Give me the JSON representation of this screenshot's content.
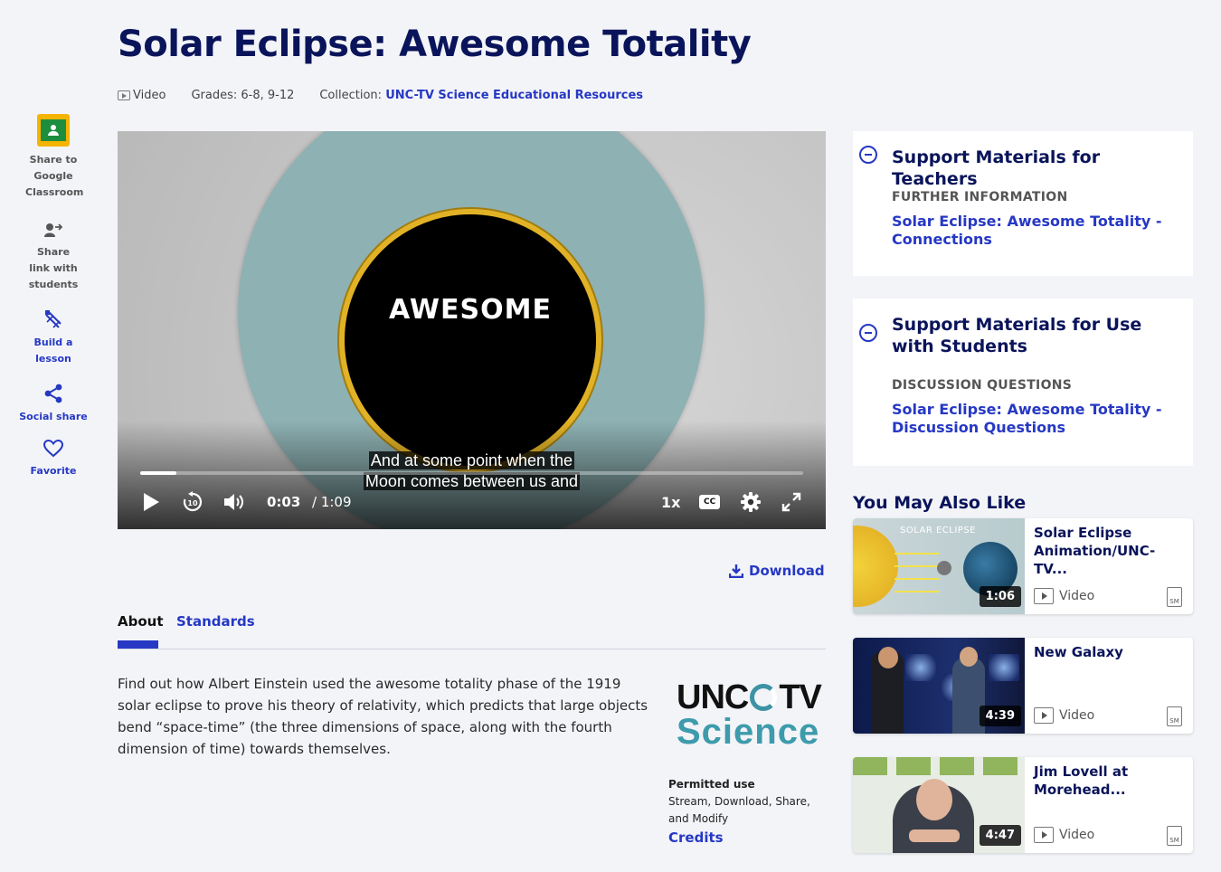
{
  "page": {
    "title": "Solar Eclipse: Awesome Totality",
    "media_type": "Video",
    "grades": "Grades: 6-8, 9-12",
    "collection_label": "Collection:",
    "collection_name": "UNC-TV Science Educational Resources"
  },
  "rail": {
    "google_classroom": "Share to Google Classroom",
    "share_link": "Share link with students",
    "build_lesson": "Build a lesson",
    "social_share": "Social share",
    "favorite": "Favorite"
  },
  "player": {
    "slide_word": "AWESOME",
    "caption_line1": "And at some point when the",
    "caption_line2": "Moon comes between us and",
    "current_time": "0:03",
    "duration": "/ 1:09",
    "progress_fraction": 0.055,
    "speed": "1x",
    "cc_label": "CC"
  },
  "download_label": "Download",
  "tabs": {
    "about": "About",
    "standards": "Standards"
  },
  "about_text": "Find out how Albert Einstein used the awesome totality phase of the 1919 solar eclipse to prove his theory of relativity, which predicts that large objects bend “space-time” (the three dimensions of space, along with the fourth dimension of time) towards themselves.",
  "logo": {
    "line1_left": "UNC",
    "line1_right": "TV",
    "line2": "Science"
  },
  "permitted": {
    "heading": "Permitted use",
    "value": "Stream, Download, Share, and Modify",
    "credits": "Credits"
  },
  "support_teachers": {
    "heading": "Support Materials for Teachers",
    "subheading": "FURTHER INFORMATION",
    "link": "Solar Eclipse: Awesome Totality - Connections"
  },
  "support_students": {
    "heading": "Support Materials for Use with Students",
    "subheading": "DISCUSSION QUESTIONS",
    "link": "Solar Eclipse: Awesome Totality - Discussion Questions"
  },
  "you_may_also_like": {
    "heading": "You May Also Like",
    "items": [
      {
        "title": "Solar Eclipse Animation/UNC-TV...",
        "duration": "1:06",
        "type": "Video",
        "thumb_text": "SOLAR ECLIPSE"
      },
      {
        "title": "New Galaxy",
        "duration": "4:39",
        "type": "Video"
      },
      {
        "title": "Jim Lovell at Morehead...",
        "duration": "4:47",
        "type": "Video"
      }
    ],
    "sm_label": "SM"
  },
  "colors": {
    "accent": "#2638c4",
    "title": "#0a145a",
    "logo_teal": "#3d9bac"
  }
}
